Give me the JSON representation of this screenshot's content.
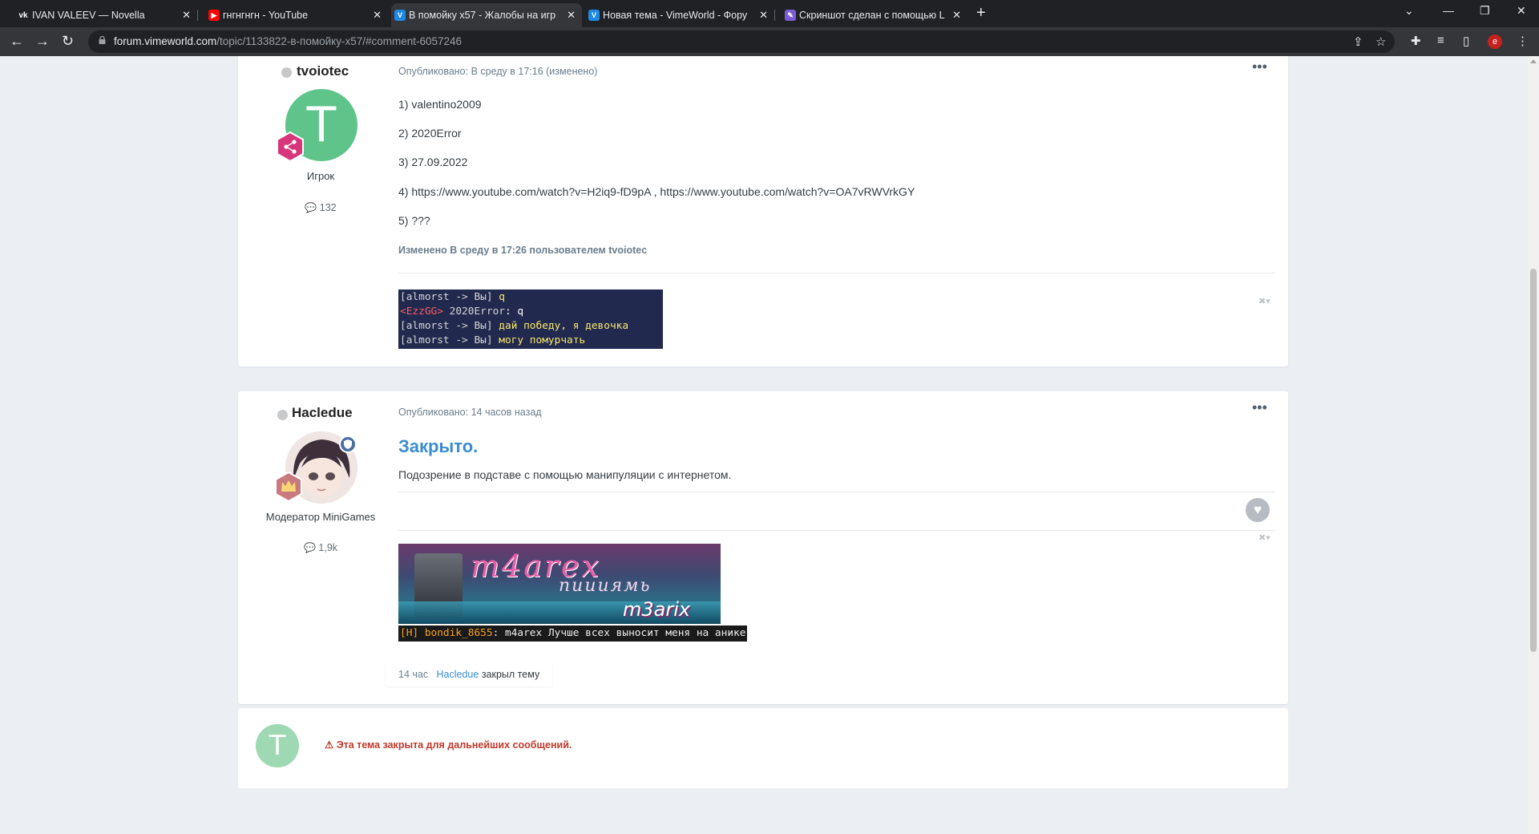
{
  "browser": {
    "tabs": [
      {
        "title": "IVAN VALEEV — Novella",
        "favicon": "vk-icon",
        "favicon_color": "#202124",
        "active": false
      },
      {
        "title": "гнгнгнгн - YouTube",
        "favicon": "youtube-icon",
        "favicon_color": "#ff0000",
        "active": false
      },
      {
        "title": "В помойку x57 - Жалобы на игр",
        "favicon": "vimeworld-icon",
        "favicon_color": "#1e88e5",
        "active": true
      },
      {
        "title": "Новая тема - VimeWorld - Фору",
        "favicon": "vimeworld-icon",
        "favicon_color": "#1e88e5",
        "active": false
      },
      {
        "title": "Скриншот сделан с помощью L",
        "favicon": "lightshot-icon",
        "favicon_color": "#7b5cd6",
        "active": false
      }
    ],
    "new_tab": "+",
    "address": {
      "host": "forum.vimeworld.com",
      "path": "/topic/1133822-в-помойку-x57/#comment-6057246"
    },
    "profile_letter": "e"
  },
  "posts": [
    {
      "author": "tvoiotec",
      "avatar_letter": "T",
      "avatar_color": "#5ec48a",
      "role": "Игрок",
      "post_count": "132",
      "meta": "Опубликовано: В среду в 17:16 (изменено)",
      "lines": [
        "1) valentino2009",
        "2) 2020Error",
        "3) 27.09.2022",
        "4) https://www.youtube.com/watch?v=H2iq9-fD9pA   ,  https://www.youtube.com/watch?v=OA7vRWVrkGY",
        "5) ???"
      ],
      "edited": "Изменено В среду в 17:26 пользователем tvoiotec",
      "signature_chat": [
        {
          "prefix": "[almorst -> Вы] ",
          "text": "q"
        },
        {
          "prefix": "<EzzGG> ",
          "name": "2020Error",
          "text": ": q"
        },
        {
          "prefix": "[almorst -> Вы] ",
          "text": "дай победу, я девочка"
        },
        {
          "prefix": "[almorst -> Вы] ",
          "text": "могу помурчать"
        }
      ]
    },
    {
      "author": "Hacledue",
      "role": "Модератор MiniGames",
      "role_color": "#3a8dd1",
      "post_count": "1,9k",
      "meta": "Опубликовано: 14 часов назад",
      "title": "Закрыто.",
      "body": "Подозрение в подставе с помощью манипуляции с интернетом.",
      "banner": {
        "text1": "m4arex",
        "text2": "пиииямь",
        "text3": "m3arix"
      },
      "signature_chat": {
        "tag": "[H] bondik_8655",
        "text": ": m4arex Лучше всех выносит меня на анике"
      }
    }
  ],
  "event": {
    "time": "14 час",
    "user": "Hacledue",
    "action": "закрыл тему"
  },
  "locked_notice": {
    "avatar_letter": "T",
    "message": "Эта тема закрыта для дальнейших сообщений."
  }
}
